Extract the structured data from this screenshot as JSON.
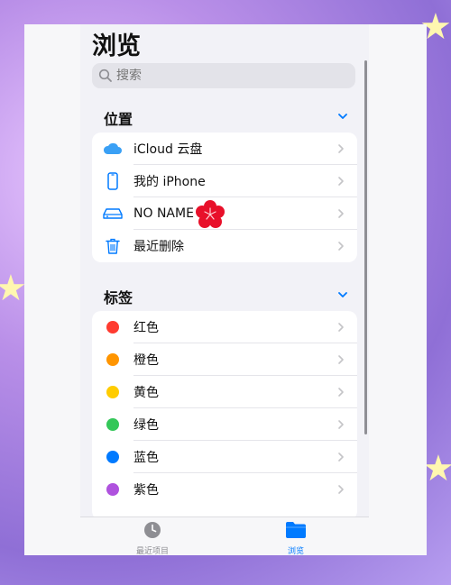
{
  "header": {
    "title": "浏览"
  },
  "search": {
    "placeholder": "搜索"
  },
  "locations": {
    "title": "位置",
    "items": [
      {
        "label": "iCloud 云盘",
        "icon": "icloud-icon"
      },
      {
        "label": "我的 iPhone",
        "icon": "iphone-icon"
      },
      {
        "label": "NO NAME",
        "icon": "drive-icon"
      },
      {
        "label": "最近删除",
        "icon": "trash-icon"
      }
    ]
  },
  "tags": {
    "title": "标签",
    "items": [
      {
        "label": "红色",
        "color": "#ff3b30"
      },
      {
        "label": "橙色",
        "color": "#ff9500"
      },
      {
        "label": "黄色",
        "color": "#ffcc00"
      },
      {
        "label": "绿色",
        "color": "#34c759"
      },
      {
        "label": "蓝色",
        "color": "#007aff"
      },
      {
        "label": "紫色",
        "color": "#af52de"
      }
    ]
  },
  "tabbar": {
    "recents_label": "最近项目",
    "browse_label": "浏览"
  },
  "colors": {
    "accent": "#007aff",
    "inactive": "#8e8e93"
  }
}
